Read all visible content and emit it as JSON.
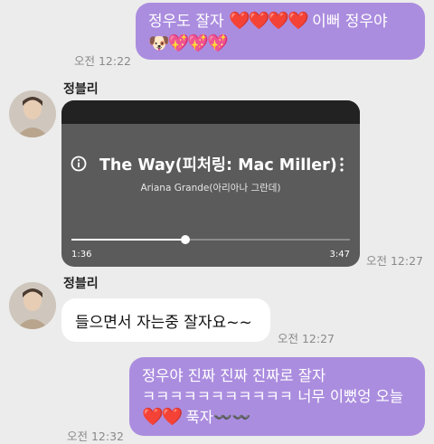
{
  "messages": {
    "m1": {
      "line1": "정우도 잘자",
      "hearts1": "❤️❤️❤️❤️",
      "line1_tail": "이뻐 정우야",
      "line2_emoji": "🐶💖💖💖",
      "time": "오전 12:22"
    },
    "sender": {
      "name": "정블리"
    },
    "music": {
      "title": "The Way(피처링: Mac Miller)",
      "artist": "Ariana Grande(아리아나 그란데)",
      "elapsed": "1:36",
      "duration": "3:47",
      "progress": 0.41,
      "time": "오전 12:27"
    },
    "m2": {
      "text": "들으면서 자는중 잘자요~~",
      "time": "오전 12:27"
    },
    "m3": {
      "line1": "정우야 진짜 진짜 진짜로 잘자",
      "line2": "ㅋㅋㅋㅋㅋㅋㅋㅋㅋㅋㅋ 너무 이뻤엉 오늘",
      "line3_hearts": "❤️❤️",
      "line3_text": "푹자〰️〰️",
      "time": "오전 12:32"
    }
  },
  "colors": {
    "background": "#ececec",
    "outgoing_bubble": "#ab8ddf",
    "incoming_bubble": "#ffffff",
    "card": "#5b5b5b"
  },
  "icons": {
    "info": "info-icon",
    "menu": "more-vertical-icon"
  }
}
